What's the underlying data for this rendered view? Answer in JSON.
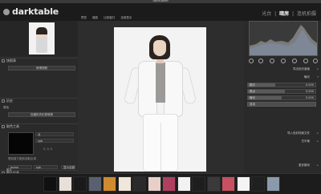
{
  "window": {
    "title": "darktable"
  },
  "header": {
    "brand": "darktable",
    "version": "",
    "views": [
      "光台",
      "暗房",
      "连机拍摄"
    ],
    "active_view_index": 1
  },
  "left_panel": {
    "sections": [
      {
        "label": "快照表"
      },
      {
        "label": "历史"
      },
      {
        "label": "取色工具"
      }
    ],
    "snapshot_button": "获得快照",
    "history_item": "原始",
    "history_button": "压缩历史纪录堆栈",
    "color_picker": {
      "mode": "点",
      "space": "rgb",
      "values_text": "0, 0, 0",
      "restrict_text": "限制直方图到选取区域",
      "readout_label": "mean",
      "readout_value": "rgb",
      "button": "显示全部"
    },
    "bottom_section": "图片信息"
  },
  "center": {
    "toolbar": [
      "预览",
      "缩放",
      "比较窗口",
      "全部显示"
    ]
  },
  "right_panel": {
    "accent": "#5a5a5a",
    "sections": [
      {
        "label": "导出到光桌面"
      },
      {
        "label": "曝光"
      },
      {
        "label": "导入色彩档案文件"
      },
      {
        "label": "白平衡"
      },
      {
        "label": "更多模块"
      }
    ],
    "sliders": [
      {
        "name": "模式",
        "value": "0.000",
        "level": 0.4
      },
      {
        "name": "黑点",
        "value": "0.000",
        "level": 0.55
      },
      {
        "name": "曝光",
        "value": "0.000",
        "level": 0.5
      }
    ],
    "auto_button": "自动",
    "histogram_colors": [
      "#b0b0b0",
      "#7f8fa8",
      "#8aa0b8"
    ]
  },
  "filmstrip": {
    "label": "胶片",
    "thumbs": [
      "#101010",
      "#e8e0d8",
      "#1a1a1a",
      "#5a6070",
      "#d08a30",
      "#f0e6da",
      "#2a2a2a",
      "#e8d0c8",
      "#b04060",
      "#f2f2f2",
      "#1e1e1e",
      "#3a3a3a",
      "#c85060",
      "#f4f4f4",
      "#202020",
      "#8a9aaa"
    ]
  }
}
